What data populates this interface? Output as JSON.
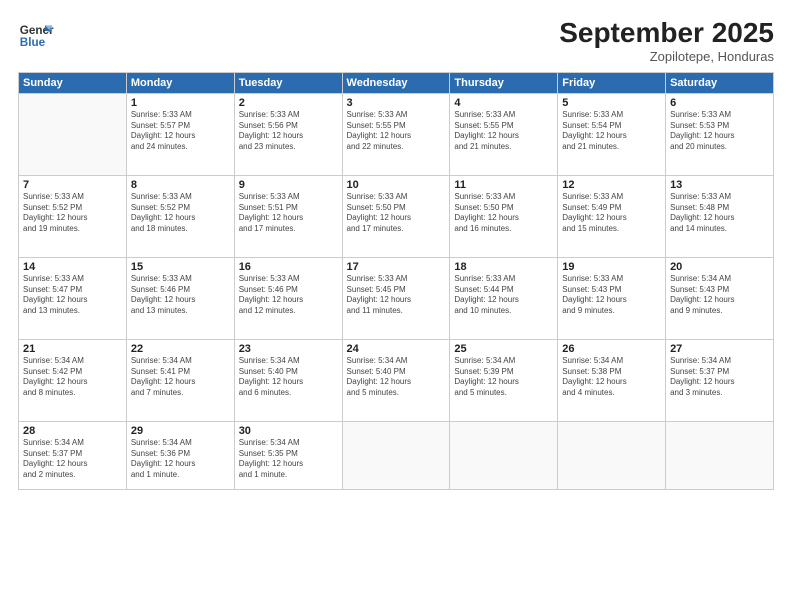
{
  "header": {
    "logo_line1": "General",
    "logo_line2": "Blue",
    "month": "September 2025",
    "location": "Zopilotepe, Honduras"
  },
  "weekdays": [
    "Sunday",
    "Monday",
    "Tuesday",
    "Wednesday",
    "Thursday",
    "Friday",
    "Saturday"
  ],
  "weeks": [
    [
      {
        "day": "",
        "text": ""
      },
      {
        "day": "1",
        "text": "Sunrise: 5:33 AM\nSunset: 5:57 PM\nDaylight: 12 hours\nand 24 minutes."
      },
      {
        "day": "2",
        "text": "Sunrise: 5:33 AM\nSunset: 5:56 PM\nDaylight: 12 hours\nand 23 minutes."
      },
      {
        "day": "3",
        "text": "Sunrise: 5:33 AM\nSunset: 5:55 PM\nDaylight: 12 hours\nand 22 minutes."
      },
      {
        "day": "4",
        "text": "Sunrise: 5:33 AM\nSunset: 5:55 PM\nDaylight: 12 hours\nand 21 minutes."
      },
      {
        "day": "5",
        "text": "Sunrise: 5:33 AM\nSunset: 5:54 PM\nDaylight: 12 hours\nand 21 minutes."
      },
      {
        "day": "6",
        "text": "Sunrise: 5:33 AM\nSunset: 5:53 PM\nDaylight: 12 hours\nand 20 minutes."
      }
    ],
    [
      {
        "day": "7",
        "text": "Sunrise: 5:33 AM\nSunset: 5:52 PM\nDaylight: 12 hours\nand 19 minutes."
      },
      {
        "day": "8",
        "text": "Sunrise: 5:33 AM\nSunset: 5:52 PM\nDaylight: 12 hours\nand 18 minutes."
      },
      {
        "day": "9",
        "text": "Sunrise: 5:33 AM\nSunset: 5:51 PM\nDaylight: 12 hours\nand 17 minutes."
      },
      {
        "day": "10",
        "text": "Sunrise: 5:33 AM\nSunset: 5:50 PM\nDaylight: 12 hours\nand 17 minutes."
      },
      {
        "day": "11",
        "text": "Sunrise: 5:33 AM\nSunset: 5:50 PM\nDaylight: 12 hours\nand 16 minutes."
      },
      {
        "day": "12",
        "text": "Sunrise: 5:33 AM\nSunset: 5:49 PM\nDaylight: 12 hours\nand 15 minutes."
      },
      {
        "day": "13",
        "text": "Sunrise: 5:33 AM\nSunset: 5:48 PM\nDaylight: 12 hours\nand 14 minutes."
      }
    ],
    [
      {
        "day": "14",
        "text": "Sunrise: 5:33 AM\nSunset: 5:47 PM\nDaylight: 12 hours\nand 13 minutes."
      },
      {
        "day": "15",
        "text": "Sunrise: 5:33 AM\nSunset: 5:46 PM\nDaylight: 12 hours\nand 13 minutes."
      },
      {
        "day": "16",
        "text": "Sunrise: 5:33 AM\nSunset: 5:46 PM\nDaylight: 12 hours\nand 12 minutes."
      },
      {
        "day": "17",
        "text": "Sunrise: 5:33 AM\nSunset: 5:45 PM\nDaylight: 12 hours\nand 11 minutes."
      },
      {
        "day": "18",
        "text": "Sunrise: 5:33 AM\nSunset: 5:44 PM\nDaylight: 12 hours\nand 10 minutes."
      },
      {
        "day": "19",
        "text": "Sunrise: 5:33 AM\nSunset: 5:43 PM\nDaylight: 12 hours\nand 9 minutes."
      },
      {
        "day": "20",
        "text": "Sunrise: 5:34 AM\nSunset: 5:43 PM\nDaylight: 12 hours\nand 9 minutes."
      }
    ],
    [
      {
        "day": "21",
        "text": "Sunrise: 5:34 AM\nSunset: 5:42 PM\nDaylight: 12 hours\nand 8 minutes."
      },
      {
        "day": "22",
        "text": "Sunrise: 5:34 AM\nSunset: 5:41 PM\nDaylight: 12 hours\nand 7 minutes."
      },
      {
        "day": "23",
        "text": "Sunrise: 5:34 AM\nSunset: 5:40 PM\nDaylight: 12 hours\nand 6 minutes."
      },
      {
        "day": "24",
        "text": "Sunrise: 5:34 AM\nSunset: 5:40 PM\nDaylight: 12 hours\nand 5 minutes."
      },
      {
        "day": "25",
        "text": "Sunrise: 5:34 AM\nSunset: 5:39 PM\nDaylight: 12 hours\nand 5 minutes."
      },
      {
        "day": "26",
        "text": "Sunrise: 5:34 AM\nSunset: 5:38 PM\nDaylight: 12 hours\nand 4 minutes."
      },
      {
        "day": "27",
        "text": "Sunrise: 5:34 AM\nSunset: 5:37 PM\nDaylight: 12 hours\nand 3 minutes."
      }
    ],
    [
      {
        "day": "28",
        "text": "Sunrise: 5:34 AM\nSunset: 5:37 PM\nDaylight: 12 hours\nand 2 minutes."
      },
      {
        "day": "29",
        "text": "Sunrise: 5:34 AM\nSunset: 5:36 PM\nDaylight: 12 hours\nand 1 minute."
      },
      {
        "day": "30",
        "text": "Sunrise: 5:34 AM\nSunset: 5:35 PM\nDaylight: 12 hours\nand 1 minute."
      },
      {
        "day": "",
        "text": ""
      },
      {
        "day": "",
        "text": ""
      },
      {
        "day": "",
        "text": ""
      },
      {
        "day": "",
        "text": ""
      }
    ]
  ]
}
